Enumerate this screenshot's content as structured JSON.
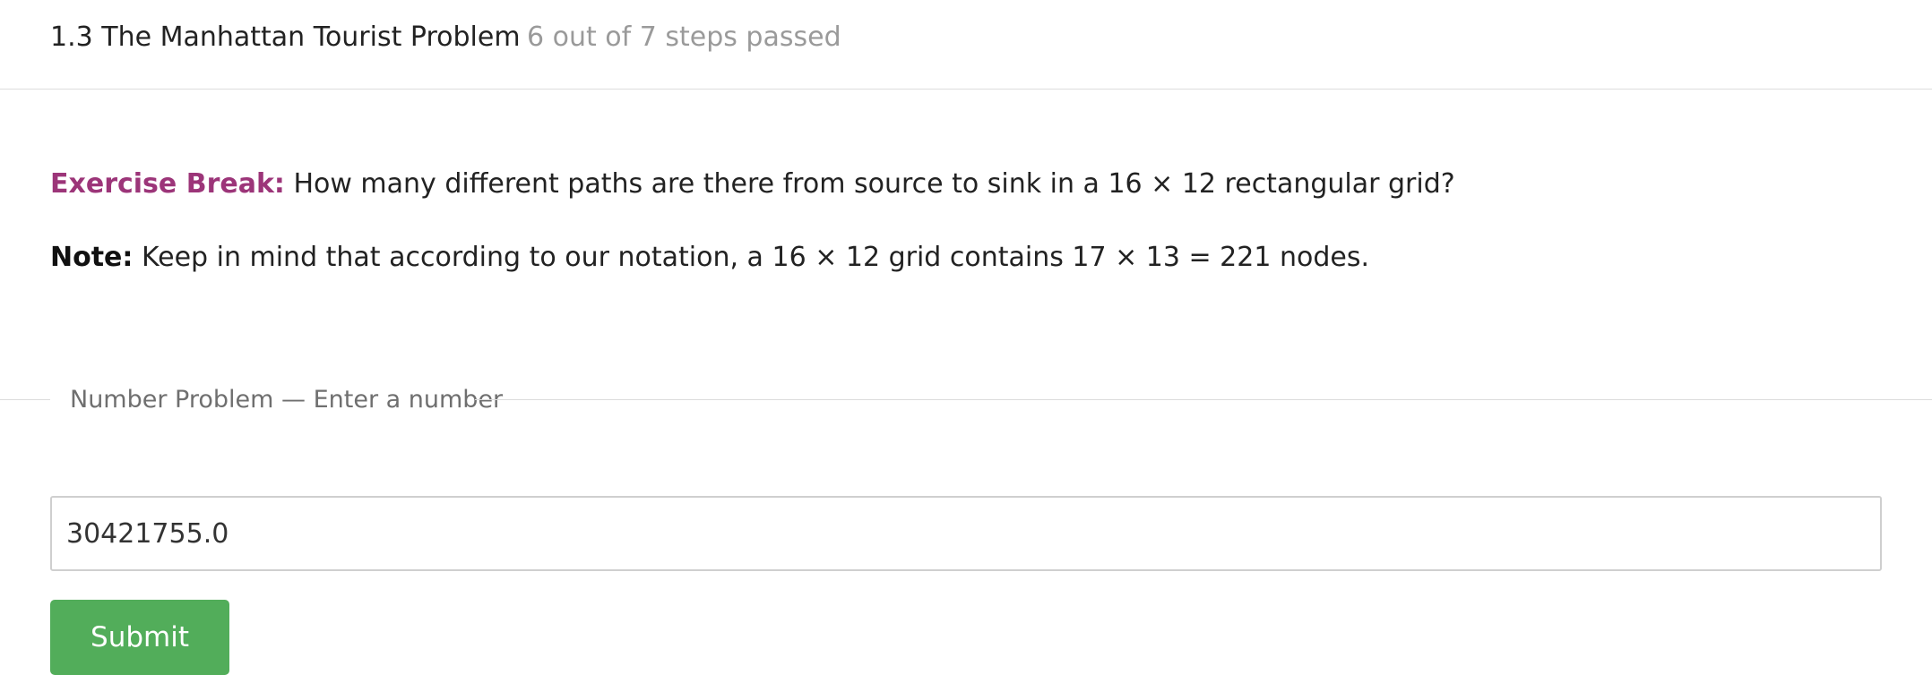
{
  "header": {
    "title": "1.3 The Manhattan Tourist Problem",
    "progress": "6 out of 7 steps passed"
  },
  "content": {
    "exercise_label": "Exercise Break:",
    "exercise_text": " How many different paths are there from source to sink in a 16 × 12 rectangular grid?",
    "note_label": "Note:",
    "note_text": " Keep in mind that according to our notation, a 16 × 12 grid contains 17 × 13 = 221 nodes."
  },
  "problem": {
    "legend": "Number Problem — Enter a number",
    "answer_value": "30421755.0",
    "submit_label": "Submit"
  },
  "colors": {
    "exercise_accent": "#9c3579",
    "submit_green": "#52ad5a",
    "muted_text": "#9a9a9a"
  }
}
